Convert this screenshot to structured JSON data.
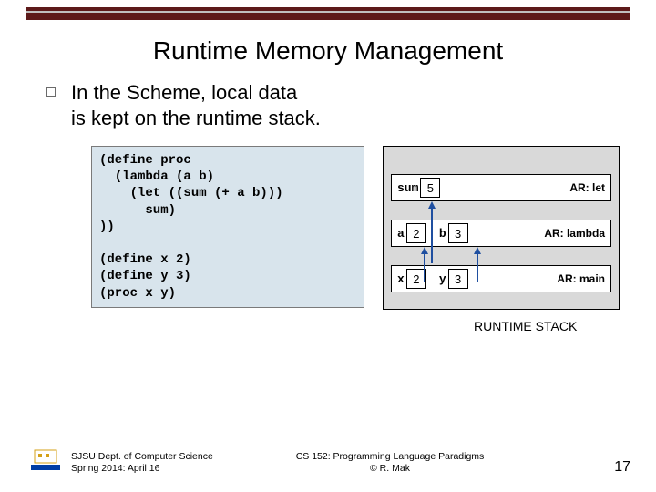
{
  "title": "Runtime Memory Management",
  "bullet": "In the Scheme, local data\nis kept on the runtime stack.",
  "code": "(define proc\n  (lambda (a b)\n    (let ((sum (+ a b)))\n      sum)\n))\n\n(define x 2)\n(define y 3)\n(proc x y)",
  "stack": {
    "frames": [
      {
        "tag": "AR: let",
        "vars": [
          {
            "name": "sum",
            "value": "5"
          }
        ]
      },
      {
        "tag": "AR: lambda",
        "vars": [
          {
            "name": "a",
            "value": "2"
          },
          {
            "name": "b",
            "value": "3"
          }
        ]
      },
      {
        "tag": "AR: main",
        "vars": [
          {
            "name": "x",
            "value": "2"
          },
          {
            "name": "y",
            "value": "3"
          }
        ]
      }
    ],
    "label": "RUNTIME STACK"
  },
  "footer": {
    "dept": "SJSU Dept. of Computer Science",
    "term": "Spring 2014: April 16",
    "course": "CS 152: Programming Language Paradigms",
    "author": "© R. Mak",
    "page": "17"
  },
  "icons": {
    "logo_name": "sjsu-logo"
  }
}
